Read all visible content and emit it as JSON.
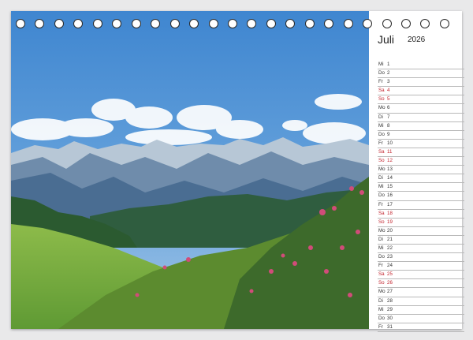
{
  "calendar": {
    "month": "Juli",
    "year": "2026",
    "weekend_color": "#c2212b",
    "days": [
      {
        "wd": "Mi",
        "d": "1",
        "weekend": false
      },
      {
        "wd": "Do",
        "d": "2",
        "weekend": false
      },
      {
        "wd": "Fr",
        "d": "3",
        "weekend": false
      },
      {
        "wd": "Sa",
        "d": "4",
        "weekend": true
      },
      {
        "wd": "So",
        "d": "5",
        "weekend": true
      },
      {
        "wd": "Mo",
        "d": "6",
        "weekend": false
      },
      {
        "wd": "Di",
        "d": "7",
        "weekend": false
      },
      {
        "wd": "Mi",
        "d": "8",
        "weekend": false
      },
      {
        "wd": "Do",
        "d": "9",
        "weekend": false
      },
      {
        "wd": "Fr",
        "d": "10",
        "weekend": false
      },
      {
        "wd": "Sa",
        "d": "11",
        "weekend": true
      },
      {
        "wd": "So",
        "d": "12",
        "weekend": true
      },
      {
        "wd": "Mo",
        "d": "13",
        "weekend": false
      },
      {
        "wd": "Di",
        "d": "14",
        "weekend": false
      },
      {
        "wd": "Mi",
        "d": "15",
        "weekend": false
      },
      {
        "wd": "Do",
        "d": "16",
        "weekend": false
      },
      {
        "wd": "Fr",
        "d": "17",
        "weekend": false
      },
      {
        "wd": "Sa",
        "d": "18",
        "weekend": true
      },
      {
        "wd": "So",
        "d": "19",
        "weekend": true
      },
      {
        "wd": "Mo",
        "d": "20",
        "weekend": false
      },
      {
        "wd": "Di",
        "d": "21",
        "weekend": false
      },
      {
        "wd": "Mi",
        "d": "22",
        "weekend": false
      },
      {
        "wd": "Do",
        "d": "23",
        "weekend": false
      },
      {
        "wd": "Fr",
        "d": "24",
        "weekend": false
      },
      {
        "wd": "Sa",
        "d": "25",
        "weekend": true
      },
      {
        "wd": "So",
        "d": "26",
        "weekend": true
      },
      {
        "wd": "Mo",
        "d": "27",
        "weekend": false
      },
      {
        "wd": "Di",
        "d": "28",
        "weekend": false
      },
      {
        "wd": "Mi",
        "d": "29",
        "weekend": false
      },
      {
        "wd": "Do",
        "d": "30",
        "weekend": false
      },
      {
        "wd": "Fr",
        "d": "31",
        "weekend": false
      }
    ]
  },
  "binding": {
    "ring_count": 23
  },
  "photo": {
    "subject": "mountain-landscape-photo"
  }
}
